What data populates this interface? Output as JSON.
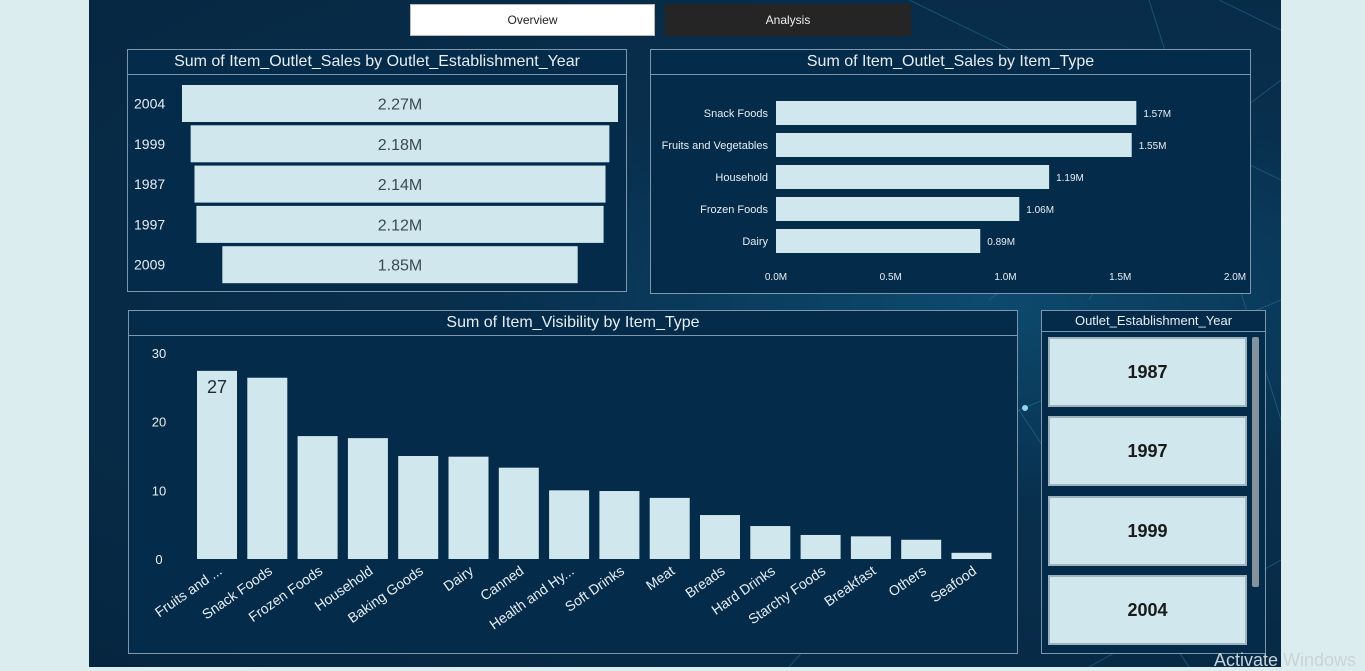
{
  "tabs": [
    {
      "label": "Overview",
      "active": true
    },
    {
      "label": "Analysis",
      "active": false
    }
  ],
  "colors": {
    "bar": "#d0e7ee",
    "panel_bg": "#052b4a",
    "canvas_bg": "#082f4d",
    "text": "#e6eef4"
  },
  "year_sales": {
    "title": "Sum of Item_Outlet_Sales by Outlet_Establishment_Year",
    "chart_data": {
      "type": "bar",
      "orientation": "horizontal",
      "categories": [
        "2004",
        "1999",
        "1987",
        "1997",
        "2009"
      ],
      "values": [
        2.27,
        2.18,
        2.14,
        2.12,
        1.85
      ],
      "data_labels": [
        "2.27M",
        "2.18M",
        "2.14M",
        "2.12M",
        "1.85M"
      ],
      "unit": "M"
    }
  },
  "type_sales": {
    "title": "Sum of Item_Outlet_Sales by Item_Type",
    "chart_data": {
      "type": "bar",
      "orientation": "horizontal",
      "categories": [
        "Snack Foods",
        "Fruits and Vegetables",
        "Household",
        "Frozen Foods",
        "Dairy"
      ],
      "values": [
        1.57,
        1.55,
        1.19,
        1.06,
        0.89
      ],
      "data_labels": [
        "1.57M",
        "1.55M",
        "1.19M",
        "1.06M",
        "0.89M"
      ],
      "xlim": [
        0,
        2.0
      ],
      "x_ticks": [
        "0.0M",
        "0.5M",
        "1.0M",
        "1.5M",
        "2.0M"
      ],
      "grid": false
    }
  },
  "visibility": {
    "title": "Sum of Item_Visibility by Item_Type",
    "chart_data": {
      "type": "bar",
      "categories": [
        "Fruits and ...",
        "Snack Foods",
        "Frozen Foods",
        "Household",
        "Baking Goods",
        "Dairy",
        "Canned",
        "Health and Hy...",
        "Soft Drinks",
        "Meat",
        "Breads",
        "Hard Drinks",
        "Starchy Foods",
        "Breakfast",
        "Others",
        "Seafood"
      ],
      "values": [
        27.4,
        26.4,
        17.9,
        17.6,
        15.0,
        14.9,
        13.3,
        10.0,
        9.9,
        8.9,
        6.4,
        4.8,
        3.5,
        3.3,
        2.8,
        0.9
      ],
      "data_labels": [
        "27"
      ],
      "ylim": [
        0,
        30
      ],
      "y_ticks": [
        "0",
        "10",
        "20",
        "30"
      ],
      "grid": false
    }
  },
  "slicer": {
    "title": "Outlet_Establishment_Year",
    "items": [
      "1987",
      "1997",
      "1999",
      "2004"
    ]
  },
  "watermark": "Activate Windows"
}
